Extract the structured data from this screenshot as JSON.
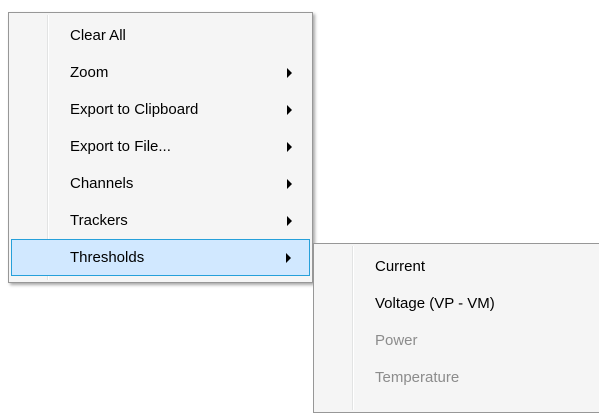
{
  "context_menu": {
    "items": [
      {
        "label": "Clear All",
        "has_submenu": false
      },
      {
        "label": "Zoom",
        "has_submenu": true
      },
      {
        "label": "Export to Clipboard",
        "has_submenu": true
      },
      {
        "label": "Export to File...",
        "has_submenu": true
      },
      {
        "label": "Channels",
        "has_submenu": true
      },
      {
        "label": "Trackers",
        "has_submenu": true
      },
      {
        "label": "Thresholds",
        "has_submenu": true,
        "highlighted": true
      }
    ]
  },
  "thresholds_submenu": {
    "items": [
      {
        "label": "Current",
        "enabled": true
      },
      {
        "label": "Voltage (VP - VM)",
        "enabled": true
      },
      {
        "label": "Power",
        "enabled": false
      },
      {
        "label": "Temperature",
        "enabled": false
      }
    ]
  },
  "colors": {
    "menu_background": "#f5f5f5",
    "highlight_background": "#d1e8ff",
    "highlight_border": "#26a0da",
    "disabled_text": "#8c8c8c"
  },
  "icons": {
    "submenu_arrow": "chevron-right-icon"
  }
}
